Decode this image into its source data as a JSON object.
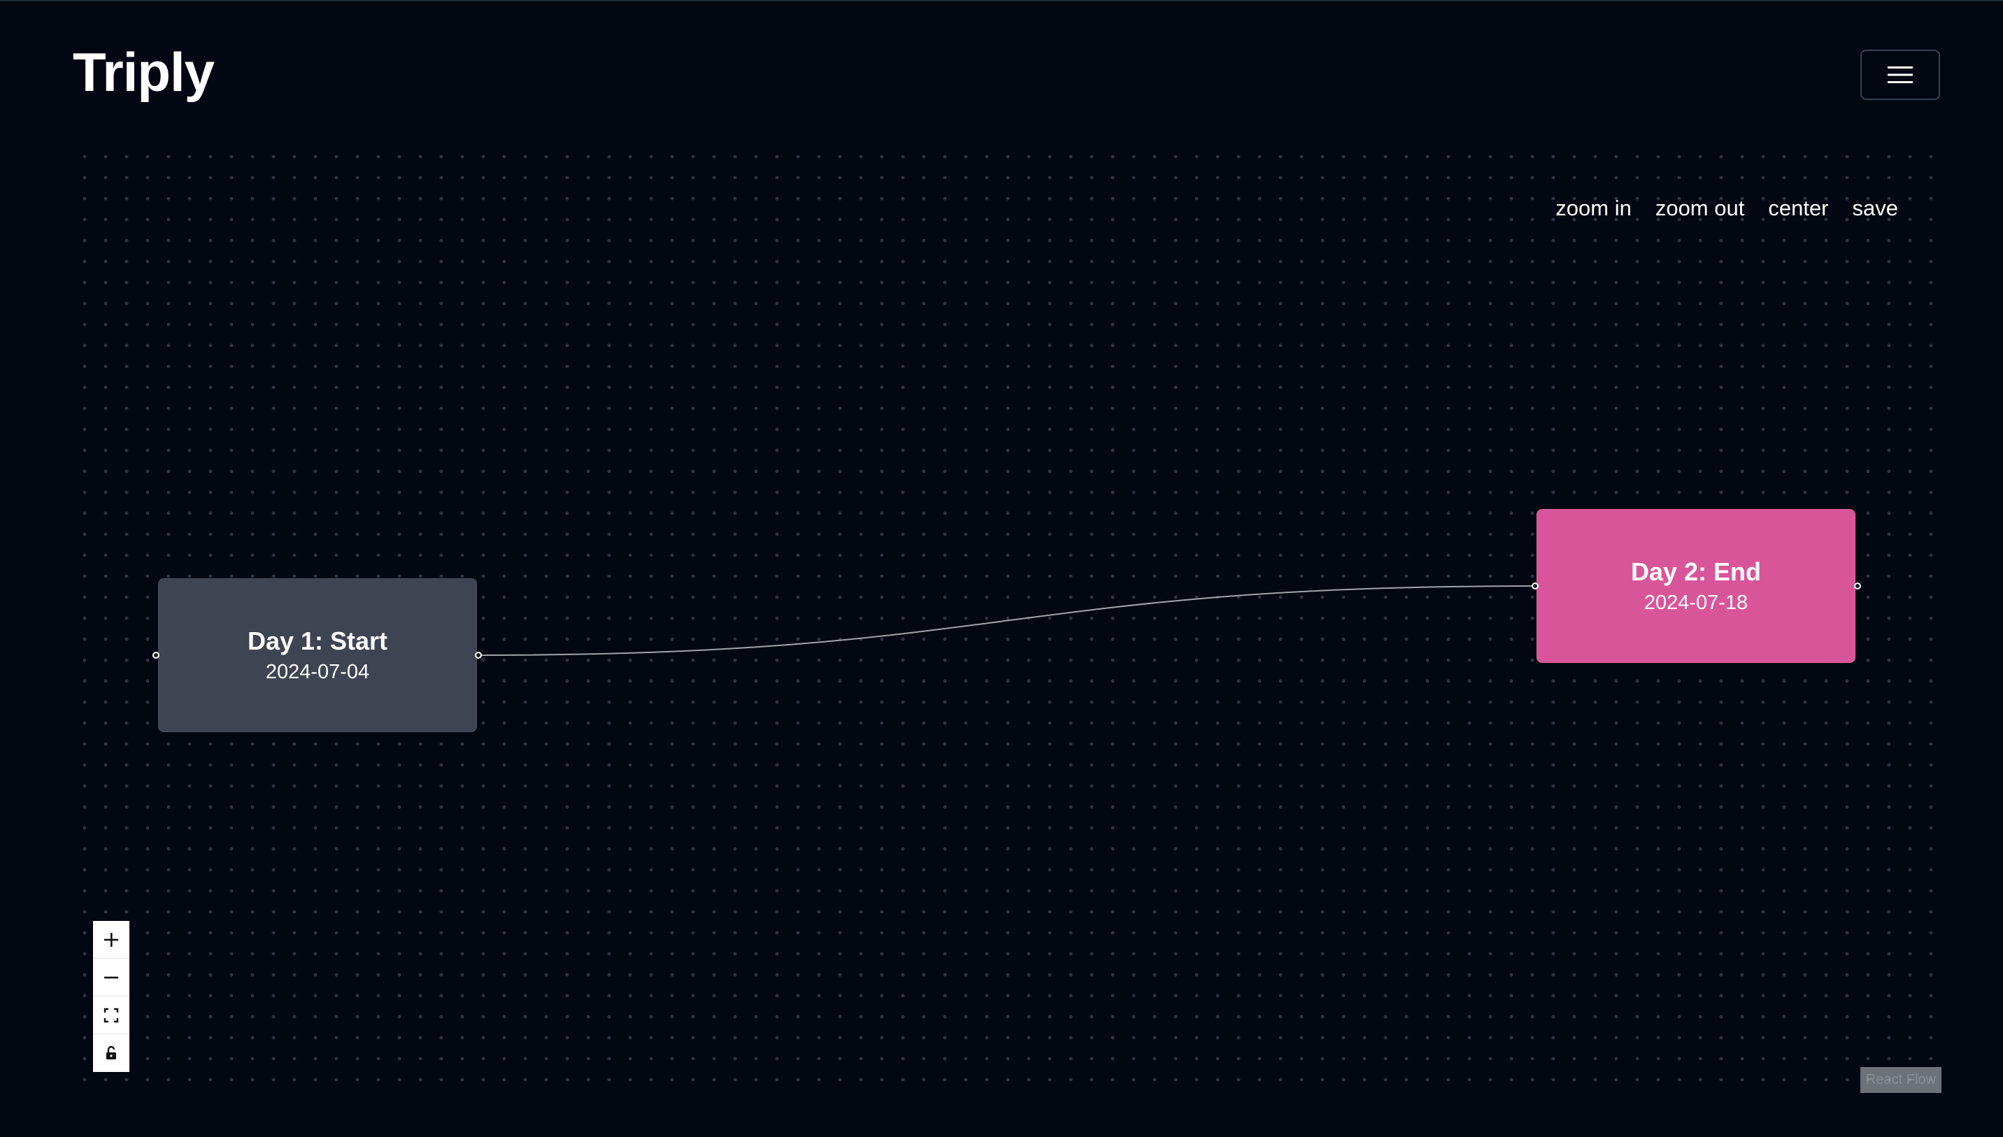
{
  "app": {
    "brand": "Triply",
    "menu_icon": "hamburger-menu-icon"
  },
  "toolbar": {
    "zoom_in": "zoom in",
    "zoom_out": "zoom out",
    "center": "center",
    "save": "save"
  },
  "nodes": [
    {
      "title": "Day 1: Start",
      "date": "2024-07-04",
      "color": "#3f4452"
    },
    {
      "title": "Day 2: End",
      "date": "2024-07-18",
      "color": "#d9559a"
    }
  ],
  "edge": {
    "color": "#a0a4ab",
    "from": "Day 1: Start",
    "to": "Day 2: End"
  },
  "controls": {
    "items": [
      {
        "icon": "plus-icon"
      },
      {
        "icon": "minus-icon"
      },
      {
        "icon": "fit-view-icon"
      },
      {
        "icon": "unlock-icon"
      }
    ]
  },
  "attribution": "React Flow",
  "colors": {
    "background": "#030712",
    "accent_pink": "#d9559a",
    "node_gray": "#3f4452"
  }
}
